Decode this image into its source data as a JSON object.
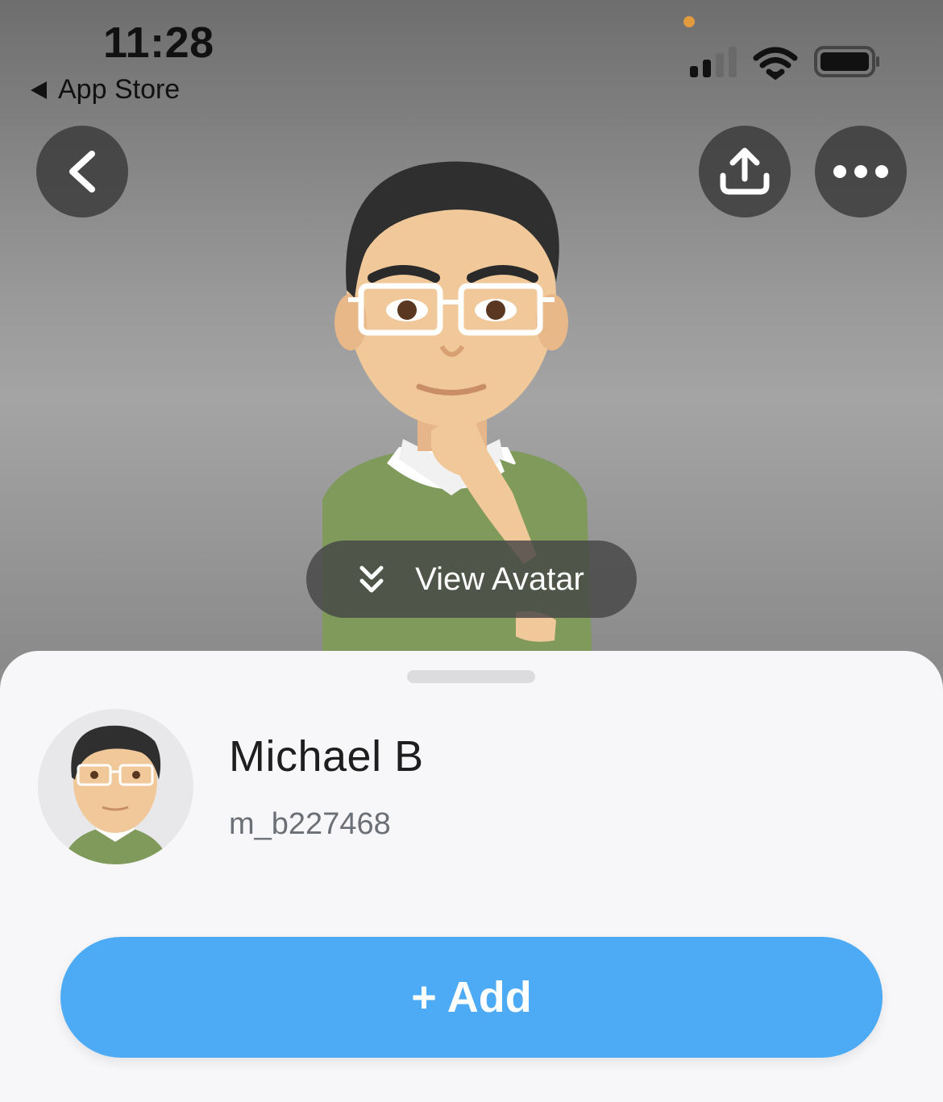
{
  "status_bar": {
    "time": "11:28",
    "back_app_label": "App Store"
  },
  "header": {
    "back_icon": "chevron-left-icon",
    "share_icon": "share-upload-icon",
    "more_icon": "ellipsis-icon"
  },
  "hero": {
    "view_avatar_label": "View Avatar",
    "view_avatar_icon": "double-chevron-down-icon"
  },
  "profile": {
    "display_name": "Michael B",
    "username": "m_b227468"
  },
  "actions": {
    "add_label": "+ Add"
  },
  "colors": {
    "accent": "#4dabf5",
    "sheet_bg": "#f7f7f9",
    "recording_dot": "#e19a3c"
  }
}
